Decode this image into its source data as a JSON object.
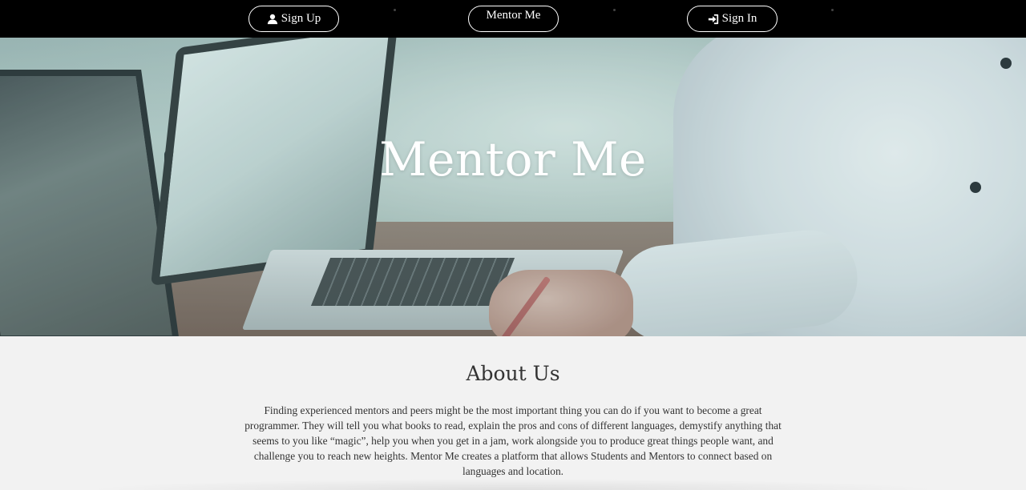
{
  "nav": {
    "signup_label": "Sign Up",
    "mentor_label": "Mentor Me",
    "signin_label": "Sign In",
    "signup_icon": "user-icon",
    "signin_icon": "sign-in-icon"
  },
  "hero": {
    "title": "Mentor Me"
  },
  "about": {
    "heading": "About Us",
    "body": "Finding experienced mentors and peers might be the most important thing you can do if you want to become a great programmer. They will tell you what books to read, explain the pros and cons of different languages, demystify anything that seems to you like “magic”, help you when you get in a jam, work alongside you to produce great things people want, and challenge you to reach new heights. Mentor Me creates a platform that allows Students and Mentors to connect based on languages and location."
  },
  "colors": {
    "nav_background": "#000000",
    "page_background": "#f2f2f2",
    "text": "#333333",
    "hero_text": "#ffffff"
  }
}
